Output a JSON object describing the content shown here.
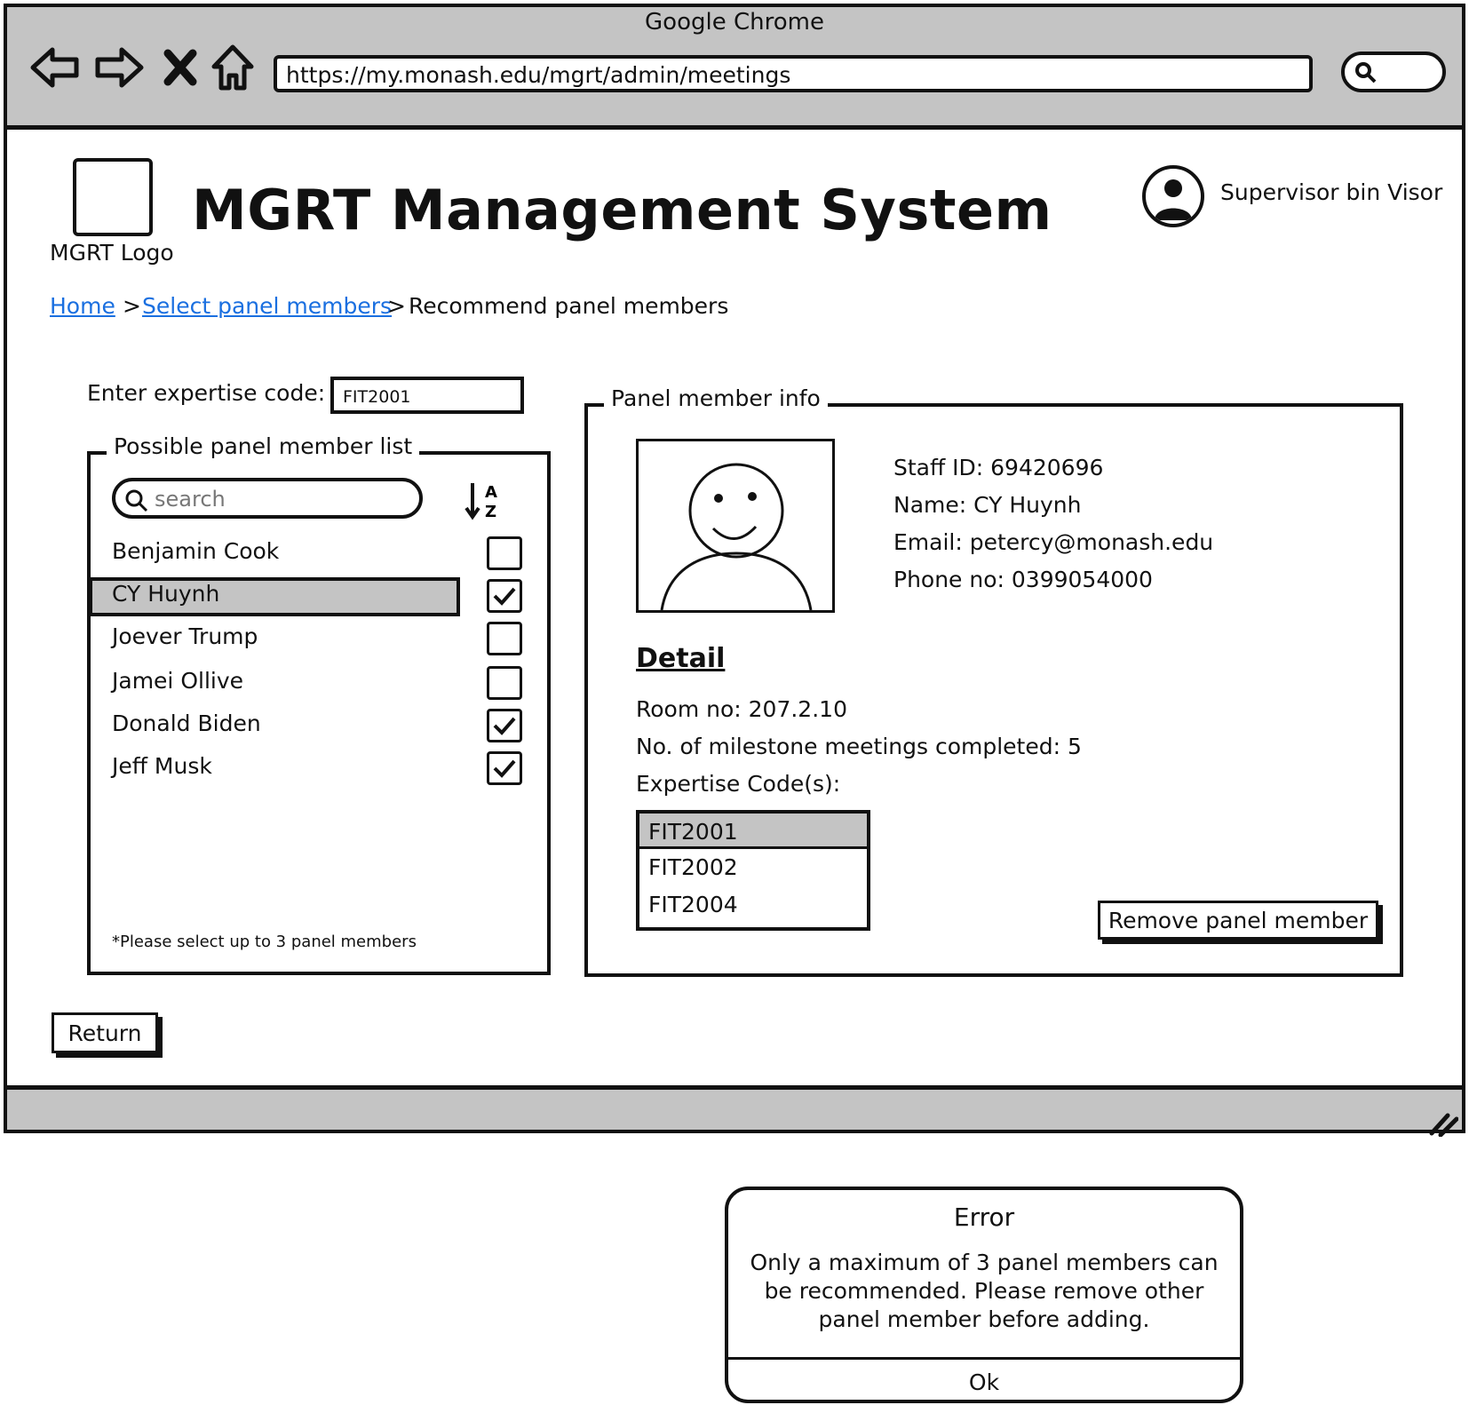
{
  "browser": {
    "app_title": "Google Chrome",
    "url": "https://my.monash.edu/mgrt/admin/meetings",
    "nav_icons": [
      "back-arrow-icon",
      "forward-arrow-icon",
      "close-icon",
      "home-icon"
    ],
    "search_icon": "search-icon",
    "resize_icon": "resize-grip-icon"
  },
  "header": {
    "logo_label": "MGRT Logo",
    "title": "MGRT Management System",
    "user_name": "Supervisor bin Visor",
    "user_icon": "user-avatar-icon"
  },
  "breadcrumb": {
    "home": "Home",
    "select": "Select panel members",
    "current": "Recommend panel members",
    "separator": ">"
  },
  "expertise": {
    "label": "Enter expertise code:",
    "value": "FIT2001"
  },
  "member_list": {
    "legend": "Possible panel member list",
    "search_placeholder": "search",
    "sort_icon": "sort-alpha-icon",
    "items": [
      {
        "name": "Benjamin Cook",
        "checked": false,
        "selected": false
      },
      {
        "name": "CY Huynh",
        "checked": true,
        "selected": true
      },
      {
        "name": "Joever Trump",
        "checked": false,
        "selected": false
      },
      {
        "name": "Jamei Ollive",
        "checked": false,
        "selected": false
      },
      {
        "name": "Donald Biden",
        "checked": true,
        "selected": false
      },
      {
        "name": "Jeff Musk",
        "checked": true,
        "selected": false
      }
    ],
    "note": "*Please select up to 3 panel members"
  },
  "member_info": {
    "legend": "Panel member info",
    "staff_id": "Staff ID: 69420696",
    "name": "Name: CY Huynh",
    "email": "Email: petercy@monash.edu",
    "phone": "Phone no: 0399054000",
    "detail_heading": "Detail",
    "room": "Room no: 207.2.10",
    "meetings": "No. of milestone meetings completed: 5",
    "codes_label": "Expertise Code(s):",
    "codes": [
      "FIT2001",
      "FIT2002",
      "FIT2004"
    ],
    "remove_button": "Remove panel member"
  },
  "return_button": "Return",
  "error_dialog": {
    "title": "Error",
    "message": "Only a maximum of 3 panel members can be recommended. Please remove other panel member before adding.",
    "ok": "Ok"
  }
}
